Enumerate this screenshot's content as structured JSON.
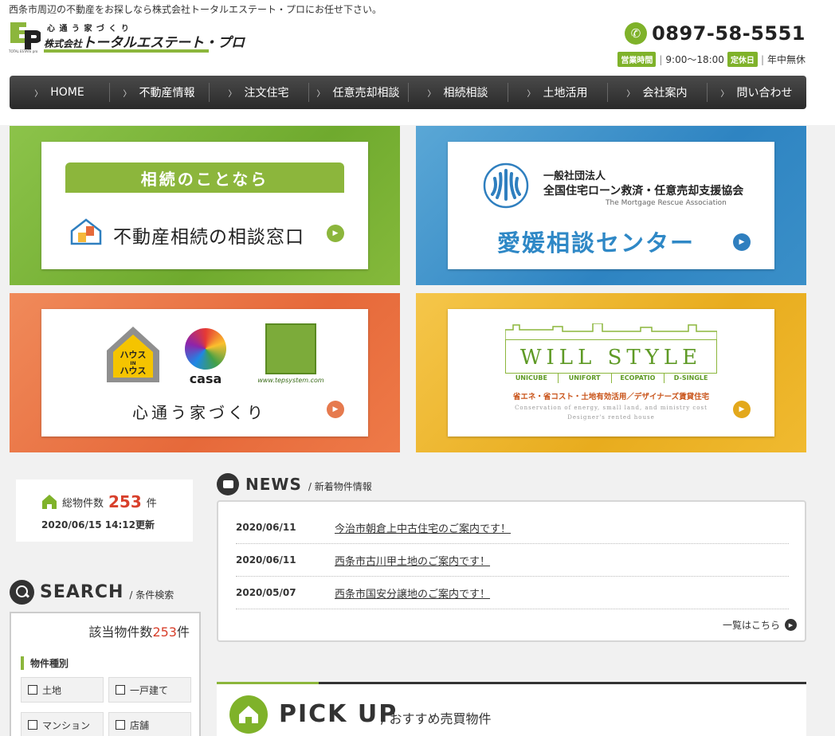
{
  "header": {
    "tagline": "西条市周辺の不動産をお探しなら株式会社トータルエステート・プロにお任せ下さい。",
    "logo_sub": "心 通 う 家 づ く り",
    "logo_corp": "株式会社",
    "logo_main": "トータルエステート・プロ",
    "logo_tiny": "TOTAL ESTATE pro",
    "phone": "0897-58-5551",
    "hours_badge": "営業時間",
    "hours": "9:00〜18:00",
    "holiday_badge": "定休日",
    "holiday": "年中無休",
    "sep": "|"
  },
  "nav": [
    "HOME",
    "不動産情報",
    "注文住宅",
    "任意売却相談",
    "相続相談",
    "土地活用",
    "会社案内",
    "問い合わせ"
  ],
  "banners": {
    "inherit": {
      "head": "相続のことなら",
      "text": "不動産相続の相談窓口"
    },
    "mortgage": {
      "org1": "一般社団法人",
      "org2": "全国住宅ローン救済・任意売却支援協会",
      "org3": "The Mortgage Rescue Association",
      "center": "愛媛相談センター"
    },
    "house": {
      "houseinhouse": "ハウスINハウス",
      "casa": "casa",
      "tep_url": "www.tepsystem.com",
      "text": "心通う家づくり"
    },
    "willstyle": {
      "title": "WILL STYLE",
      "types": [
        "UNICUBE",
        "UNIFORT",
        "ECOPATIO",
        "D-SINGLE"
      ],
      "jp": "省エネ・省コスト・土地有効活用／デザイナーズ賃貸住宅",
      "en1": "Conservation of energy, small land, and ministry cost",
      "en2": "Designer's rented house"
    }
  },
  "count": {
    "label": "総物件数",
    "num": "253",
    "unit": "件",
    "updated": "2020/06/15 14:12更新"
  },
  "search": {
    "title": "SEARCH",
    "sub": "/ 条件検索",
    "hits_label": "該当物件数",
    "hits_num": "253",
    "hits_unit": "件",
    "kind_label": "物件種別",
    "kinds": [
      "土地",
      "一戸建て",
      "マンション",
      "店舗"
    ]
  },
  "news": {
    "title": "NEWS",
    "sub": "/ 新着物件情報",
    "items": [
      {
        "date": "2020/06/11",
        "text": "今治市朝倉上中古住宅のご案内です！"
      },
      {
        "date": "2020/06/11",
        "text": "西条市古川甲土地のご案内です！"
      },
      {
        "date": "2020/05/07",
        "text": "西条市国安分譲地のご案内です！"
      }
    ],
    "more": "一覧はこちら"
  },
  "pickup": {
    "title": "PICK UP",
    "sub": "/ おすすめ売買物件"
  },
  "colors": {
    "accent": "#8cb63c",
    "nav": "#333333",
    "highlight": "#d8402c",
    "blue": "#2f88c6",
    "orange": "#e6693a",
    "yellow": "#e8ac1e"
  }
}
